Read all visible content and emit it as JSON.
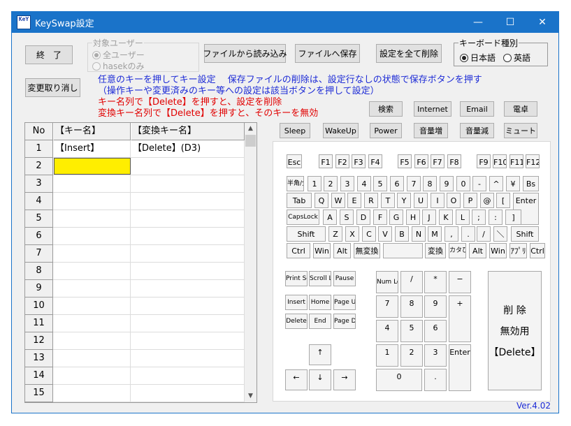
{
  "titlebar": {
    "icon_text": "KeY",
    "title": "KeySwap設定",
    "min": "—",
    "max": "☐",
    "close": "✕"
  },
  "buttons": {
    "exit": "終　了",
    "load": "ファイルから読み込み",
    "save": "ファイルへ保存",
    "delete_all": "設定を全て削除",
    "undo": "変更取り消し"
  },
  "target_user": {
    "label": "対象ユーザー",
    "all": "全ユーザー",
    "only": "hasekのみ",
    "selected": "all"
  },
  "kb_type": {
    "label": "キーボード種別",
    "jp": "日本語",
    "en": "英語",
    "selected": "jp"
  },
  "info": {
    "line1": "任意のキーを押してキー設定　 保存ファイルの削除は、設定行なしの状態で保存ボタンを押す",
    "line2": "（操作キーや変更済みのキー等への設定は該当ボタンを押して設定）",
    "line3": "キー名列で【Delete】を押すと、設定を削除",
    "line4": "変換キー名列で【Delete】を押すと、そのキーを無効"
  },
  "special_keys": [
    "検索",
    "Internet",
    "Email",
    "電卓",
    "Sleep",
    "WakeUp",
    "Power",
    "音量増",
    "音量減",
    "ミュート"
  ],
  "grid": {
    "headers": [
      "No",
      "【キー名】",
      "【変換キー名】"
    ],
    "rows": [
      {
        "no": "1",
        "key": "【Insert】",
        "value": "【Delete】(D3)"
      },
      {
        "no": "2",
        "key": "",
        "value": ""
      },
      {
        "no": "3",
        "key": "",
        "value": ""
      },
      {
        "no": "4",
        "key": "",
        "value": ""
      },
      {
        "no": "5",
        "key": "",
        "value": ""
      },
      {
        "no": "6",
        "key": "",
        "value": ""
      },
      {
        "no": "7",
        "key": "",
        "value": ""
      },
      {
        "no": "8",
        "key": "",
        "value": ""
      },
      {
        "no": "9",
        "key": "",
        "value": ""
      },
      {
        "no": "10",
        "key": "",
        "value": ""
      },
      {
        "no": "11",
        "key": "",
        "value": ""
      },
      {
        "no": "12",
        "key": "",
        "value": ""
      },
      {
        "no": "13",
        "key": "",
        "value": ""
      },
      {
        "no": "14",
        "key": "",
        "value": ""
      },
      {
        "no": "15",
        "key": "",
        "value": ""
      }
    ],
    "selected_cell": "row2-key",
    "scroll_up": "▲",
    "scroll_down": "▼"
  },
  "keyboard": {
    "fn": [
      "Esc",
      "F1",
      "F2",
      "F3",
      "F4",
      "F5",
      "F6",
      "F7",
      "F8",
      "F9",
      "F10",
      "F11",
      "F12"
    ],
    "num_row": [
      "半角/全角",
      "1",
      "2",
      "3",
      "4",
      "5",
      "6",
      "7",
      "8",
      "9",
      "0",
      "-",
      "^",
      "¥",
      "Bs"
    ],
    "tab_row": [
      "Tab",
      "Q",
      "W",
      "E",
      "R",
      "T",
      "Y",
      "U",
      "I",
      "O",
      "P",
      "@",
      "["
    ],
    "enter": "Enter",
    "caps_row": [
      "CapsLock",
      "A",
      "S",
      "D",
      "F",
      "G",
      "H",
      "J",
      "K",
      "L",
      ";",
      ":",
      "]"
    ],
    "shift_row": [
      "Shift",
      "Z",
      "X",
      "C",
      "V",
      "B",
      "N",
      "M",
      ",",
      ".",
      "/",
      "＼",
      "Shift"
    ],
    "bottom_row": [
      "Ctrl",
      "Win",
      "Alt",
      "無変換",
      "",
      "変換",
      "カタひら",
      "Alt",
      "Win",
      "ｱﾌﾟﾘ",
      "Ctrl"
    ],
    "nav": [
      "Print Scrn",
      "Scroll Lock",
      "Pause",
      "Insert",
      "Home",
      "Page Up",
      "Delete",
      "End",
      "Page Down"
    ],
    "arrows": [
      "↑",
      "←",
      "↓",
      "→"
    ],
    "numpad": [
      "Num Lock",
      "/",
      "*",
      "−",
      "7",
      "8",
      "9",
      "+",
      "4",
      "5",
      "6",
      "1",
      "2",
      "3",
      "Enter",
      "0",
      "."
    ],
    "action": [
      "削 除",
      "無効用",
      "【Delete】"
    ]
  },
  "version": "Ver.4.02"
}
